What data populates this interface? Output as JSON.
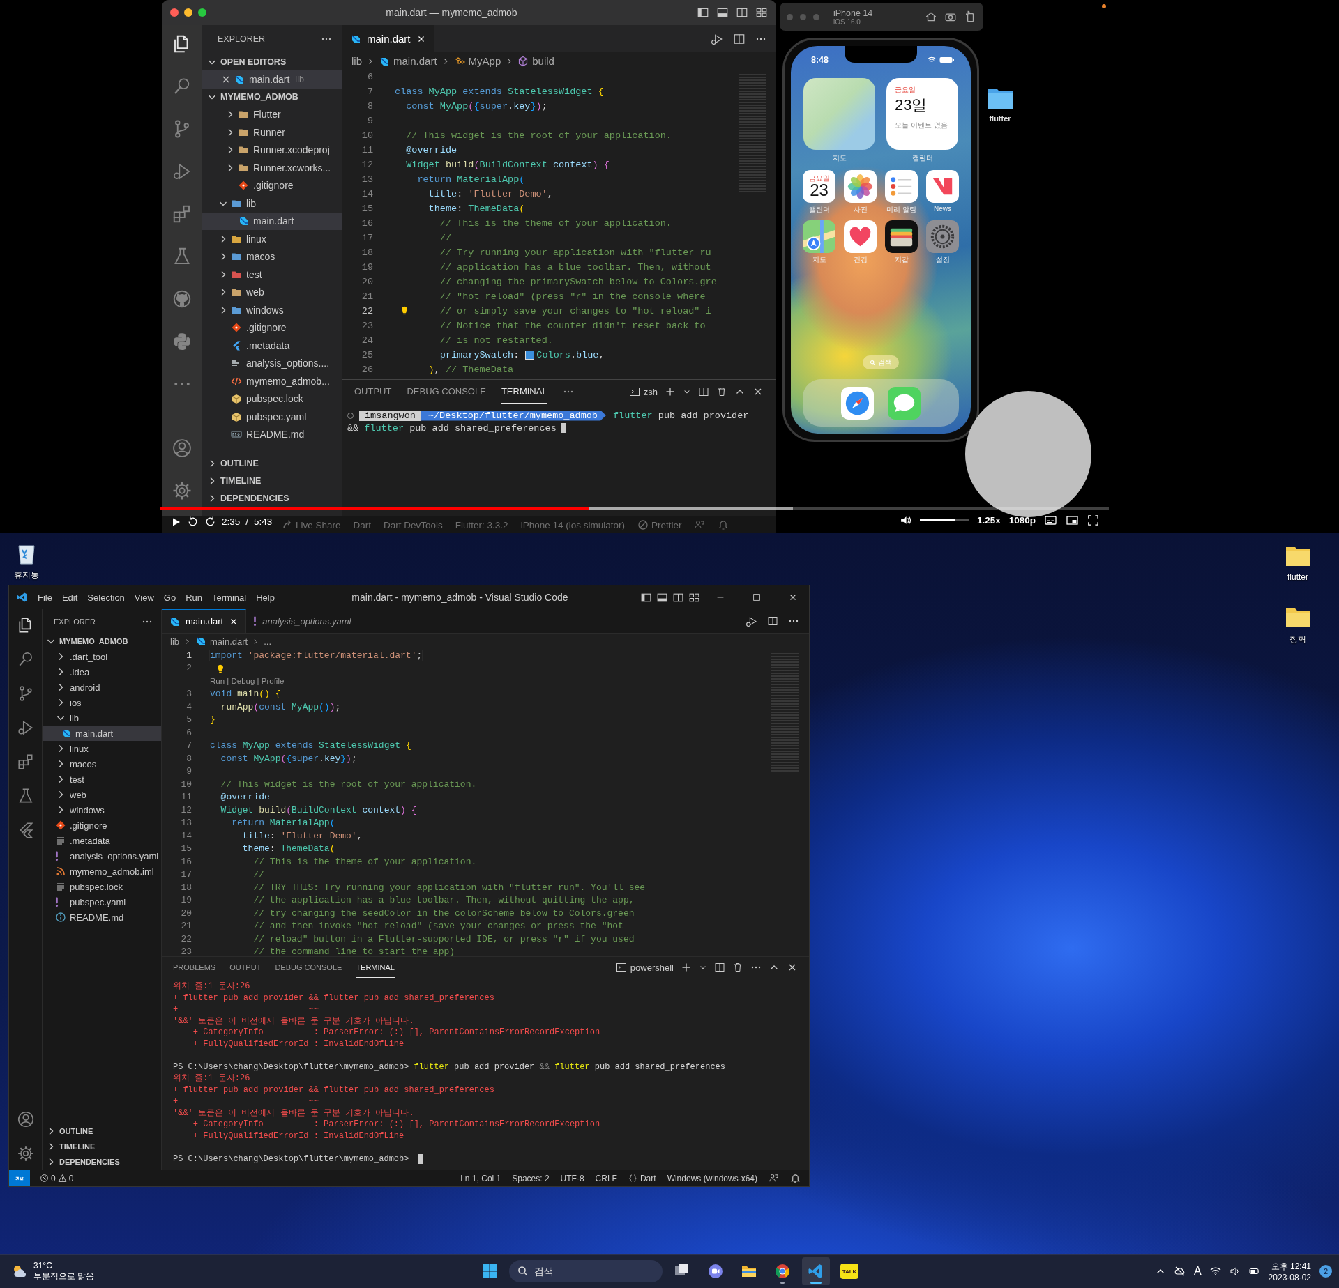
{
  "video_player": {
    "mac_vscode": {
      "title": "main.dart — mymemo_admob",
      "explorer_title": "EXPLORER",
      "open_editors": {
        "label": "OPEN EDITORS",
        "expanded": true,
        "items": [
          {
            "name": "main.dart",
            "folder": "lib",
            "kind": "dart",
            "selected": true
          }
        ]
      },
      "project": {
        "label": "MYMEMO_ADMOB",
        "expanded": true,
        "continued_children": [
          {
            "name": "Flutter",
            "kind": "folder",
            "expanded": false,
            "selected": false
          },
          {
            "name": "Runner",
            "kind": "folder",
            "expanded": false,
            "selected": false
          },
          {
            "name": "Runner.xcodeproj",
            "kind": "folder",
            "expanded": false,
            "selected": false
          },
          {
            "name": "Runner.xcworks...",
            "kind": "folder",
            "expanded": false,
            "selected": false
          },
          {
            "name": ".gitignore",
            "kind": "git",
            "selected": false
          }
        ],
        "items": [
          {
            "name": "lib",
            "kind": "bluefolder",
            "expanded": true,
            "selected": false,
            "children": [
              {
                "name": "main.dart",
                "kind": "dart",
                "selected": true
              }
            ]
          },
          {
            "name": "linux",
            "kind": "linuxfolder",
            "expanded": false,
            "selected": false
          },
          {
            "name": "macos",
            "kind": "bluefolder",
            "expanded": false,
            "selected": false
          },
          {
            "name": "test",
            "kind": "redfolder",
            "expanded": false,
            "selected": false
          },
          {
            "name": "web",
            "kind": "folder",
            "expanded": false,
            "selected": false
          },
          {
            "name": "windows",
            "kind": "bluefolder",
            "expanded": false,
            "selected": false
          },
          {
            "name": ".gitignore",
            "kind": "git",
            "selected": false
          },
          {
            "name": ".metadata",
            "kind": "flutter",
            "selected": false
          },
          {
            "name": "analysis_options....",
            "kind": "yaml",
            "selected": false
          },
          {
            "name": "mymemo_admob...",
            "kind": "xml",
            "selected": false
          },
          {
            "name": "pubspec.lock",
            "kind": "pub",
            "selected": false
          },
          {
            "name": "pubspec.yaml",
            "kind": "pub",
            "selected": false
          },
          {
            "name": "README.md",
            "kind": "md",
            "selected": false
          }
        ]
      },
      "sections": [
        {
          "label": "OUTLINE",
          "expanded": false
        },
        {
          "label": "TIMELINE",
          "expanded": false
        },
        {
          "label": "DEPENDENCIES",
          "expanded": false
        }
      ],
      "tabs": [
        {
          "label": "main.dart",
          "kind": "dart",
          "selected": true
        }
      ],
      "breadcrumbs": [
        {
          "label": "lib",
          "kind": "text"
        },
        {
          "label": "main.dart",
          "kind": "dart"
        },
        {
          "label": "MyApp",
          "kind": "class"
        },
        {
          "label": "build",
          "kind": "method"
        }
      ],
      "code_lines": [
        {
          "number": "6",
          "current": false
        },
        {
          "number": "7",
          "current": false,
          "tokens": [
            {
              "kind": "keyword",
              "text": "class "
            },
            {
              "kind": "type",
              "text": "MyApp "
            },
            {
              "kind": "keyword",
              "text": "extends "
            },
            {
              "kind": "type",
              "text": "StatelessWidget "
            },
            {
              "kind": "bracket1",
              "text": "{"
            }
          ]
        },
        {
          "number": "8",
          "current": false,
          "tokens": [
            {
              "kind": "keyword",
              "text": "  const "
            },
            {
              "kind": "type",
              "text": "MyApp"
            },
            {
              "kind": "bracket2",
              "text": "("
            },
            {
              "kind": "bracket3",
              "text": "{"
            },
            {
              "kind": "keyword",
              "text": "super"
            },
            {
              "kind": "plain",
              "text": "."
            },
            {
              "kind": "property",
              "text": "key"
            },
            {
              "kind": "bracket3",
              "text": "}"
            },
            {
              "kind": "bracket2",
              "text": ")"
            },
            {
              "kind": "plain",
              "text": ";"
            }
          ]
        },
        {
          "number": "9",
          "current": false
        },
        {
          "number": "10",
          "current": false,
          "tokens": [
            {
              "kind": "comment",
              "text": "  // This widget is the root of your application."
            }
          ]
        },
        {
          "number": "11",
          "current": false,
          "tokens": [
            {
              "kind": "property",
              "text": "  @override"
            }
          ]
        },
        {
          "number": "12",
          "current": false,
          "tokens": [
            {
              "kind": "type",
              "text": "  Widget "
            },
            {
              "kind": "function",
              "text": "build"
            },
            {
              "kind": "bracket2",
              "text": "("
            },
            {
              "kind": "type",
              "text": "BuildContext "
            },
            {
              "kind": "property",
              "text": "context"
            },
            {
              "kind": "bracket2",
              "text": ") "
            },
            {
              "kind": "bracket2",
              "text": "{"
            }
          ]
        },
        {
          "number": "13",
          "current": false,
          "tokens": [
            {
              "kind": "keyword",
              "text": "    return "
            },
            {
              "kind": "type",
              "text": "MaterialApp"
            },
            {
              "kind": "bracket3",
              "text": "("
            }
          ]
        },
        {
          "number": "14",
          "current": false,
          "tokens": [
            {
              "kind": "property",
              "text": "      title"
            },
            {
              "kind": "plain",
              "text": ": "
            },
            {
              "kind": "string",
              "text": "'Flutter Demo'"
            },
            {
              "kind": "plain",
              "text": ","
            }
          ]
        },
        {
          "number": "15",
          "current": false,
          "tokens": [
            {
              "kind": "property",
              "text": "      theme"
            },
            {
              "kind": "plain",
              "text": ": "
            },
            {
              "kind": "type",
              "text": "ThemeData"
            },
            {
              "kind": "bracket1",
              "text": "("
            }
          ]
        },
        {
          "number": "16",
          "current": false,
          "tokens": [
            {
              "kind": "comment",
              "text": "        // This is the theme of your application."
            }
          ]
        },
        {
          "number": "17",
          "current": false,
          "tokens": [
            {
              "kind": "comment",
              "text": "        //"
            }
          ]
        },
        {
          "number": "18",
          "current": false,
          "tokens": [
            {
              "kind": "comment",
              "text": "        // Try running your application with \"flutter ru"
            }
          ]
        },
        {
          "number": "19",
          "current": false,
          "tokens": [
            {
              "kind": "comment",
              "text": "        // application has a blue toolbar. Then, without"
            }
          ]
        },
        {
          "number": "20",
          "current": false,
          "tokens": [
            {
              "kind": "comment",
              "text": "        // changing the primarySwatch below to Colors.gre"
            }
          ]
        },
        {
          "number": "21",
          "current": false,
          "tokens": [
            {
              "kind": "comment",
              "text": "        // \"hot reload\" (press \"r\" in the console where"
            }
          ]
        },
        {
          "number": "22",
          "current": true,
          "lightbulb": true,
          "tokens": [
            {
              "kind": "comment",
              "text": "        // or simply save your changes to \"hot reload\" i"
            }
          ]
        },
        {
          "number": "23",
          "current": false,
          "tokens": [
            {
              "kind": "comment",
              "text": "        // Notice that the counter didn't reset back to"
            }
          ]
        },
        {
          "number": "24",
          "current": false,
          "tokens": [
            {
              "kind": "comment",
              "text": "        // is not restarted."
            }
          ]
        },
        {
          "number": "25",
          "current": false,
          "tokens": [
            {
              "kind": "property",
              "text": "        primarySwatch"
            },
            {
              "kind": "plain",
              "text": ": "
            },
            {
              "kind": "swatch"
            },
            {
              "kind": "type",
              "text": "Colors"
            },
            {
              "kind": "plain",
              "text": "."
            },
            {
              "kind": "property",
              "text": "blue"
            },
            {
              "kind": "plain",
              "text": ","
            }
          ]
        },
        {
          "number": "26",
          "current": false,
          "tokens": [
            {
              "kind": "bracket1",
              "text": "      )"
            },
            {
              "kind": "plain",
              "text": ", "
            },
            {
              "kind": "comment",
              "text": "// ThemeData"
            }
          ]
        }
      ],
      "panel_tabs": [
        {
          "label": "OUTPUT",
          "selected": false
        },
        {
          "label": "DEBUG CONSOLE",
          "selected": false
        },
        {
          "label": "TERMINAL",
          "selected": true
        }
      ],
      "shell": "zsh",
      "terminal": {
        "user": "imsangwon",
        "path": "~/Desktop/flutter/mymemo_admob",
        "command": [
          {
            "kind": "command",
            "text": "flutter"
          },
          {
            "kind": "plain",
            "text": " pub add provider"
          }
        ],
        "continuation": [
          {
            "kind": "plain",
            "text": "&& "
          },
          {
            "kind": "command",
            "text": "flutter"
          },
          {
            "kind": "plain",
            "text": " pub add shared_preferences"
          }
        ]
      },
      "status_items": [
        {
          "label": "Live Share",
          "kind": "share"
        },
        {
          "label": "Dart",
          "kind": "text"
        },
        {
          "label": "Dart DevTools",
          "kind": "text"
        },
        {
          "label": "Flutter: 3.3.2",
          "kind": "text"
        },
        {
          "label": "iPhone 14 (ios simulator)",
          "kind": "text"
        },
        {
          "label": "Prettier",
          "kind": "check"
        }
      ]
    },
    "simulator": {
      "device": "iPhone 14",
      "os": "iOS 16.0",
      "time": "8:48",
      "widgets": [
        {
          "kind": "map",
          "caption": "지도"
        },
        {
          "kind": "calendar",
          "weekday": "금요일",
          "date": "23일",
          "note": "오늘 이벤트 없음",
          "caption": "캘린더"
        }
      ],
      "apps": [
        {
          "kind": "calendar",
          "label": "캘린더",
          "weekday": "금요일",
          "day": "23"
        },
        {
          "kind": "photos",
          "label": "사진"
        },
        {
          "kind": "reminders",
          "label": "미리 알림"
        },
        {
          "kind": "news",
          "label": "News"
        },
        {
          "kind": "maps",
          "label": "지도"
        },
        {
          "kind": "health",
          "label": "건강"
        },
        {
          "kind": "wallet",
          "label": "지갑"
        },
        {
          "kind": "settings",
          "label": "설정"
        }
      ],
      "search": "검색",
      "dock": [
        {
          "kind": "safari"
        },
        {
          "kind": "messages"
        }
      ]
    },
    "desktop_folder": {
      "label": "flutter"
    },
    "controls": {
      "current_time": "2:35",
      "separator": "/",
      "duration": "5:43",
      "progress": {
        "level": 0.452,
        "buffered": {
          "level": 0.667
        }
      },
      "volume": {
        "level": 0.72
      },
      "speed": "1.25x",
      "quality": "1080p"
    }
  },
  "windows_desktop": {
    "left_icons": [
      {
        "label": "휴지통",
        "kind": "recycle"
      }
    ],
    "right_icons": [
      {
        "label": "flutter",
        "kind": "folder"
      },
      {
        "label": "창혁",
        "kind": "folder"
      }
    ],
    "vscode": {
      "menu": [
        "File",
        "Edit",
        "Selection",
        "View",
        "Go",
        "Run",
        "Terminal",
        "Help"
      ],
      "title": "main.dart - mymemo_admob - Visual Studio Code",
      "explorer_title": "EXPLORER",
      "project": {
        "label": "MYMEMO_ADMOB",
        "expanded": true,
        "items": [
          {
            "name": ".dart_tool",
            "kind": "folder",
            "expanded": false,
            "selected": false
          },
          {
            "name": ".idea",
            "kind": "folder",
            "expanded": false,
            "selected": false
          },
          {
            "name": "android",
            "kind": "folder",
            "expanded": false,
            "selected": false
          },
          {
            "name": "ios",
            "kind": "folder",
            "expanded": false,
            "selected": false
          },
          {
            "name": "lib",
            "kind": "folder",
            "expanded": true,
            "selected": false,
            "children": [
              {
                "name": "main.dart",
                "kind": "dart",
                "selected": true
              }
            ]
          },
          {
            "name": "linux",
            "kind": "folder",
            "expanded": false,
            "selected": false
          },
          {
            "name": "macos",
            "kind": "folder",
            "expanded": false,
            "selected": false
          },
          {
            "name": "test",
            "kind": "folder",
            "expanded": false,
            "selected": false
          },
          {
            "name": "web",
            "kind": "folder",
            "expanded": false,
            "selected": false
          },
          {
            "name": "windows",
            "kind": "folder",
            "expanded": false,
            "selected": false
          },
          {
            "name": ".gitignore",
            "kind": "git",
            "selected": false
          },
          {
            "name": ".metadata",
            "kind": "lines",
            "selected": false
          },
          {
            "name": "analysis_options.yaml",
            "kind": "bang",
            "selected": false
          },
          {
            "name": "mymemo_admob.iml",
            "kind": "rss",
            "selected": false
          },
          {
            "name": "pubspec.lock",
            "kind": "lines",
            "selected": false
          },
          {
            "name": "pubspec.yaml",
            "kind": "bang",
            "selected": false
          },
          {
            "name": "README.md",
            "kind": "info",
            "selected": false
          }
        ]
      },
      "sections": [
        {
          "label": "OUTLINE",
          "expanded": false
        },
        {
          "label": "TIMELINE",
          "expanded": false
        },
        {
          "label": "DEPENDENCIES",
          "expanded": false
        }
      ],
      "tabs": [
        {
          "label": "main.dart",
          "kind": "dart",
          "selected": true
        },
        {
          "label": "analysis_options.yaml",
          "kind": "bang",
          "selected": false
        }
      ],
      "breadcrumbs": [
        {
          "label": "lib",
          "kind": "text"
        },
        {
          "label": "main.dart",
          "kind": "dart"
        },
        {
          "label": "...",
          "kind": "text"
        }
      ],
      "code_lines": [
        {
          "number": "1",
          "current": true,
          "tokens": [
            {
              "kind": "keyword",
              "text": "import "
            },
            {
              "kind": "string",
              "text": "'package:flutter/material.dart'"
            },
            {
              "kind": "plain",
              "text": ";"
            }
          ]
        },
        {
          "number": "2",
          "current": false,
          "lightbulb": true
        },
        {
          "number": "3",
          "current": false,
          "codelens": "Run | Debug | Profile",
          "tokens": [
            {
              "kind": "keyword",
              "text": "void "
            },
            {
              "kind": "function",
              "text": "main"
            },
            {
              "kind": "bracket1",
              "text": "() "
            },
            {
              "kind": "bracket1",
              "text": "{"
            }
          ]
        },
        {
          "number": "4",
          "current": false,
          "tokens": [
            {
              "kind": "function",
              "text": "  runApp"
            },
            {
              "kind": "bracket2",
              "text": "("
            },
            {
              "kind": "keyword",
              "text": "const "
            },
            {
              "kind": "type",
              "text": "MyApp"
            },
            {
              "kind": "bracket3",
              "text": "()"
            },
            {
              "kind": "bracket2",
              "text": ")"
            },
            {
              "kind": "plain",
              "text": ";"
            }
          ]
        },
        {
          "number": "5",
          "current": false,
          "tokens": [
            {
              "kind": "bracket1",
              "text": "}"
            }
          ]
        },
        {
          "number": "6",
          "current": false
        },
        {
          "number": "7",
          "current": false,
          "tokens": [
            {
              "kind": "keyword",
              "text": "class "
            },
            {
              "kind": "type",
              "text": "MyApp "
            },
            {
              "kind": "keyword",
              "text": "extends "
            },
            {
              "kind": "type",
              "text": "StatelessWidget "
            },
            {
              "kind": "bracket1",
              "text": "{"
            }
          ]
        },
        {
          "number": "8",
          "current": false,
          "tokens": [
            {
              "kind": "keyword",
              "text": "  const "
            },
            {
              "kind": "type",
              "text": "MyApp"
            },
            {
              "kind": "bracket2",
              "text": "("
            },
            {
              "kind": "bracket3",
              "text": "{"
            },
            {
              "kind": "keyword",
              "text": "super"
            },
            {
              "kind": "plain",
              "text": "."
            },
            {
              "kind": "property",
              "text": "key"
            },
            {
              "kind": "bracket3",
              "text": "}"
            },
            {
              "kind": "bracket2",
              "text": ")"
            },
            {
              "kind": "plain",
              "text": ";"
            }
          ]
        },
        {
          "number": "9",
          "current": false
        },
        {
          "number": "10",
          "current": false,
          "tokens": [
            {
              "kind": "comment",
              "text": "  // This widget is the root of your application."
            }
          ]
        },
        {
          "number": "11",
          "current": false,
          "tokens": [
            {
              "kind": "property",
              "text": "  @override"
            }
          ]
        },
        {
          "number": "12",
          "current": false,
          "tokens": [
            {
              "kind": "type",
              "text": "  Widget "
            },
            {
              "kind": "function",
              "text": "build"
            },
            {
              "kind": "bracket2",
              "text": "("
            },
            {
              "kind": "type",
              "text": "BuildContext "
            },
            {
              "kind": "property",
              "text": "context"
            },
            {
              "kind": "bracket2",
              "text": ") "
            },
            {
              "kind": "bracket2",
              "text": "{"
            }
          ]
        },
        {
          "number": "13",
          "current": false,
          "tokens": [
            {
              "kind": "keyword",
              "text": "    return "
            },
            {
              "kind": "type",
              "text": "MaterialApp"
            },
            {
              "kind": "bracket3",
              "text": "("
            }
          ]
        },
        {
          "number": "14",
          "current": false,
          "tokens": [
            {
              "kind": "property",
              "text": "      title"
            },
            {
              "kind": "plain",
              "text": ": "
            },
            {
              "kind": "string",
              "text": "'Flutter Demo'"
            },
            {
              "kind": "plain",
              "text": ","
            }
          ]
        },
        {
          "number": "15",
          "current": false,
          "tokens": [
            {
              "kind": "property",
              "text": "      theme"
            },
            {
              "kind": "plain",
              "text": ": "
            },
            {
              "kind": "type",
              "text": "ThemeData"
            },
            {
              "kind": "bracket1",
              "text": "("
            }
          ]
        },
        {
          "number": "16",
          "current": false,
          "tokens": [
            {
              "kind": "comment",
              "text": "        // This is the theme of your application."
            }
          ]
        },
        {
          "number": "17",
          "current": false,
          "tokens": [
            {
              "kind": "comment",
              "text": "        //"
            }
          ]
        },
        {
          "number": "18",
          "current": false,
          "tokens": [
            {
              "kind": "comment",
              "text": "        // TRY THIS: Try running your application with \"flutter run\". You'll see"
            }
          ]
        },
        {
          "number": "19",
          "current": false,
          "tokens": [
            {
              "kind": "comment",
              "text": "        // the application has a blue toolbar. Then, without quitting the app,"
            }
          ]
        },
        {
          "number": "20",
          "current": false,
          "tokens": [
            {
              "kind": "comment",
              "text": "        // try changing the seedColor in the colorScheme below to Colors.green"
            }
          ]
        },
        {
          "number": "21",
          "current": false,
          "tokens": [
            {
              "kind": "comment",
              "text": "        // and then invoke \"hot reload\" (save your changes or press the \"hot"
            }
          ]
        },
        {
          "number": "22",
          "current": false,
          "tokens": [
            {
              "kind": "comment",
              "text": "        // reload\" button in a Flutter-supported IDE, or press \"r\" if you used"
            }
          ]
        },
        {
          "number": "23",
          "current": false,
          "tokens": [
            {
              "kind": "comment",
              "text": "        // the command line to start the app)"
            }
          ]
        }
      ],
      "panel_tabs": [
        {
          "label": "PROBLEMS",
          "selected": false
        },
        {
          "label": "OUTPUT",
          "selected": false
        },
        {
          "label": "DEBUG CONSOLE",
          "selected": false
        },
        {
          "label": "TERMINAL",
          "selected": true
        }
      ],
      "shell": "powershell",
      "terminal_lines": [
        {
          "kind": "error",
          "text": "위치 줄:1 문자:26"
        },
        {
          "kind": "error",
          "text": "+ flutter pub add provider && flutter pub add shared_preferences"
        },
        {
          "kind": "error",
          "text": "+                          ~~"
        },
        {
          "kind": "error",
          "text": "'&&' 토큰은 이 버전에서 올바른 문 구분 기호가 아닙니다."
        },
        {
          "kind": "error",
          "text": "    + CategoryInfo          : ParserError: (:) [], ParentContainsErrorRecordException"
        },
        {
          "kind": "error",
          "text": "    + FullyQualifiedErrorId : InvalidEndOfLine"
        },
        {
          "kind": "prompt",
          "blank_line_before": true,
          "prompt": "PS C:\\Users\\chang\\Desktop\\flutter\\mymemo_admob>",
          "tokens": [
            {
              "kind": "command",
              "text": "flutter"
            },
            {
              "kind": "plain",
              "text": " pub add provider "
            },
            {
              "kind": "operator",
              "text": "&& "
            },
            {
              "kind": "command",
              "text": "flutter"
            },
            {
              "kind": "plain",
              "text": " pub add shared_preferences"
            }
          ]
        },
        {
          "kind": "error",
          "text": "위치 줄:1 문자:26"
        },
        {
          "kind": "error",
          "text": "+ flutter pub add provider && flutter pub add shared_preferences"
        },
        {
          "kind": "error",
          "text": "+                          ~~"
        },
        {
          "kind": "error",
          "text": "'&&' 토큰은 이 버전에서 올바른 문 구분 기호가 아닙니다."
        },
        {
          "kind": "error",
          "text": "    + CategoryInfo          : ParserError: (:) [], ParentContainsErrorRecordException"
        },
        {
          "kind": "error",
          "text": "    + FullyQualifiedErrorId : InvalidEndOfLine"
        },
        {
          "kind": "prompt",
          "blank_line_before": true,
          "cursor": true,
          "prompt": "PS C:\\Users\\chang\\Desktop\\flutter\\mymemo_admob>"
        }
      ],
      "status": {
        "errors": "0",
        "warnings": "0",
        "items": [
          {
            "label": "Ln 1, Col 1",
            "kind": "text"
          },
          {
            "label": "Spaces: 2",
            "kind": "text"
          },
          {
            "label": "UTF-8",
            "kind": "text"
          },
          {
            "label": "CRLF",
            "kind": "text"
          },
          {
            "label": "Dart",
            "kind": "braces"
          },
          {
            "label": "Windows (windows-x64)",
            "kind": "text"
          }
        ]
      }
    },
    "taskbar": {
      "weather": {
        "temperature": "31°C",
        "condition": "부분적으로 맑음"
      },
      "search": {
        "placeholder": "검색"
      },
      "apps": [
        {
          "kind": "taskview",
          "running": false,
          "active": false
        },
        {
          "kind": "chat",
          "running": false,
          "active": false
        },
        {
          "kind": "files",
          "running": false,
          "active": false
        },
        {
          "kind": "chrome",
          "running": true,
          "active": false
        },
        {
          "kind": "vscode",
          "running": true,
          "active": true
        },
        {
          "kind": "kakaotalk",
          "text": "TALK",
          "running": false,
          "active": false
        }
      ],
      "tray": {
        "ime": "A",
        "time": "오후 12:41",
        "date": "2023-08-02",
        "notifications": "2"
      }
    }
  }
}
